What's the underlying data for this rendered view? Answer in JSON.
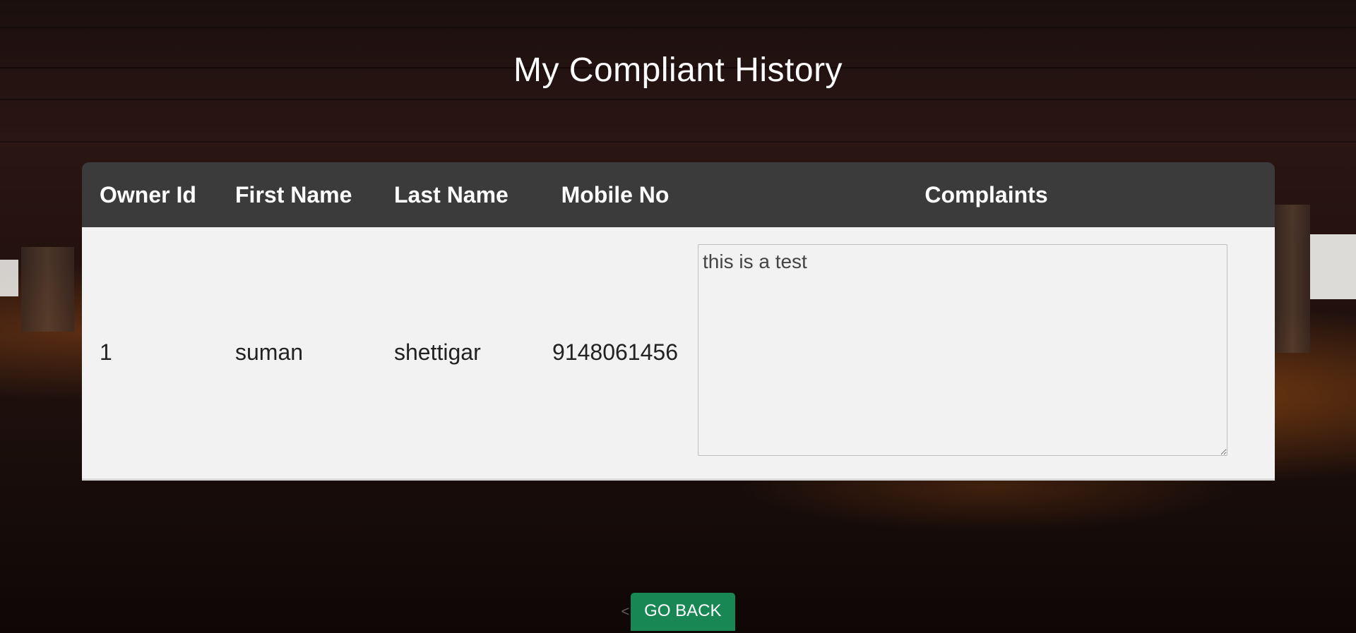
{
  "page": {
    "title": "My Compliant History"
  },
  "table": {
    "headers": {
      "owner_id": "Owner Id",
      "first_name": "First Name",
      "last_name": "Last Name",
      "mobile_no": "Mobile No",
      "complaints": "Complaints"
    },
    "rows": [
      {
        "owner_id": "1",
        "first_name": "suman",
        "last_name": "shettigar",
        "mobile_no": "9148061456",
        "complaint": "this is a test"
      }
    ]
  },
  "actions": {
    "back_arrow": "<",
    "go_back_label": "GO BACK"
  },
  "colors": {
    "header_bg": "#3b3b3b",
    "row_bg": "#f2f2f2",
    "button_bg": "#198754"
  }
}
